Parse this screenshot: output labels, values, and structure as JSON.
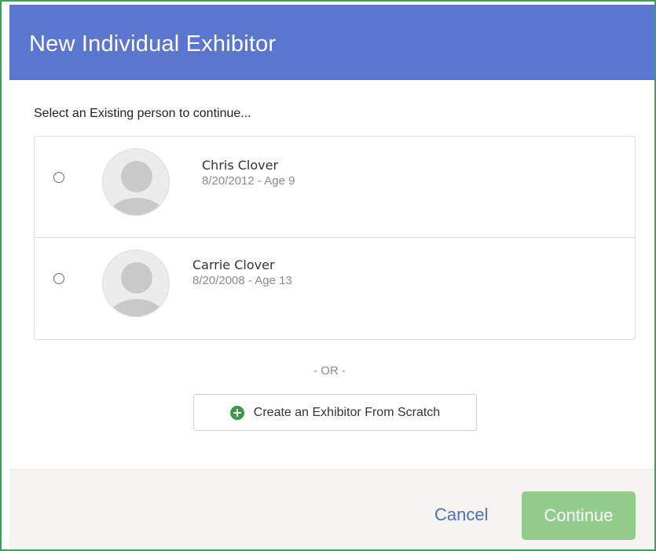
{
  "dialog": {
    "title": "New Individual Exhibitor",
    "instruction": "Select an Existing person to continue..."
  },
  "people": [
    {
      "name": "Chris Clover",
      "dob_age": "8/20/2012 - Age 9",
      "selected": false
    },
    {
      "name": "Carrie Clover",
      "dob_age": "8/20/2008 - Age 13",
      "selected": false
    }
  ],
  "or_divider": "- OR -",
  "create_button": {
    "label": "Create an Exhibitor From Scratch",
    "icon": "plus-circle-icon"
  },
  "footer": {
    "cancel_label": "Cancel",
    "continue_label": "Continue"
  },
  "colors": {
    "header": "#5b76cf",
    "border": "#2fa84f",
    "continue": "#92cc8c",
    "cancel": "#4f6fb8",
    "plus_icon": "#3b9a4a"
  }
}
